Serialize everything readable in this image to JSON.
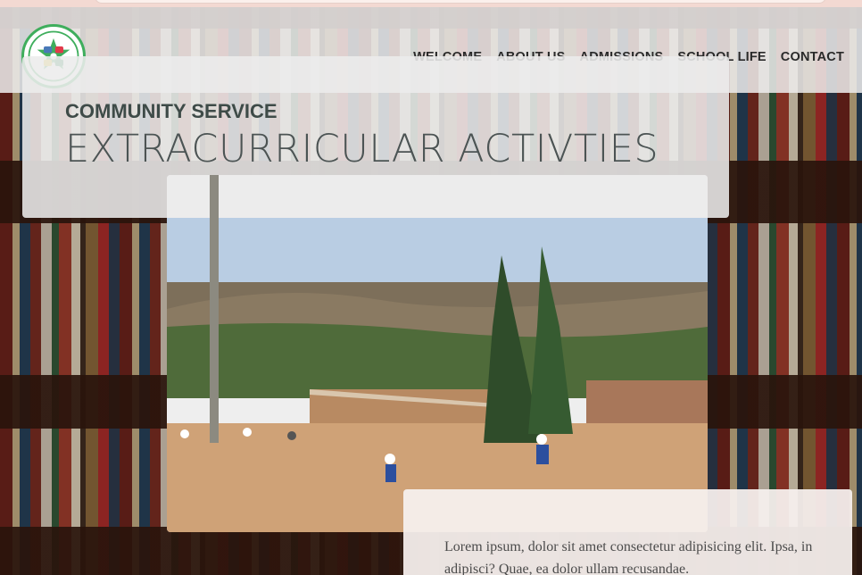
{
  "nav": {
    "items": [
      {
        "label": "WELCOME"
      },
      {
        "label": "ABOUT US"
      },
      {
        "label": "ADMISSIONS"
      },
      {
        "label": "SCHOOL LIFE"
      },
      {
        "label": "CONTACT"
      }
    ]
  },
  "logo": {
    "icon": "school-crest-logo",
    "colors": {
      "ring": "#3fae5d",
      "accent": "#e23a4a",
      "gold": "#e7c420",
      "blue": "#4a79b8"
    }
  },
  "hero": {
    "subtitle": "COMMUNITY SERVICE",
    "title": "EXTRACURRICULAR ACTIVTIES"
  },
  "photo": {
    "subject": "schoolyard-photo"
  },
  "body": {
    "text": "Lorem ipsum, dolor sit amet consectetur adipisicing elit. Ipsa, in adipisci? Quae, ea dolor ullam recusandae."
  },
  "colors": {
    "header_bg": "#eeecec",
    "title_text": "#4c5454",
    "subtitle_text": "#3e4b48"
  }
}
